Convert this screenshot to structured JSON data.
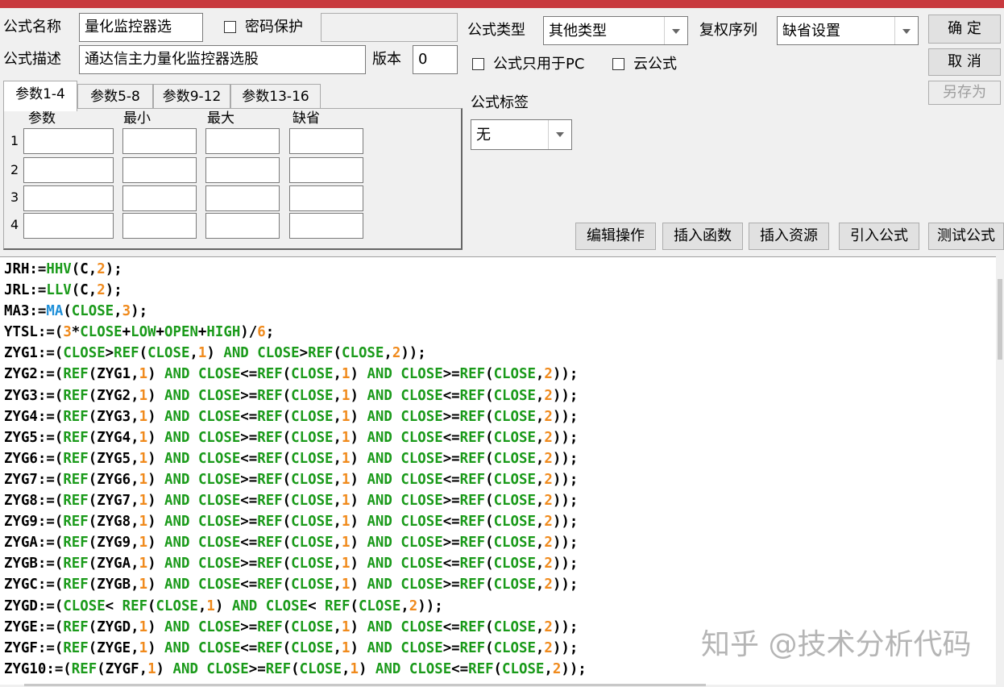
{
  "window": {
    "title_bar_color": "#c8393e"
  },
  "form": {
    "name_label": "公式名称",
    "name_value": "量化监控器选",
    "password_label": "密码保护",
    "password_value": "",
    "desc_label": "公式描述",
    "desc_value": "通达信主力量化监控器选股",
    "version_label": "版本",
    "version_value": "0",
    "type_label": "公式类型",
    "type_value": "其他类型",
    "adjust_label": "复权序列",
    "adjust_value": "缺省设置",
    "pc_only_label": "公式只用于PC",
    "cloud_label": "云公式",
    "tag_label": "公式标签",
    "tag_value": "无"
  },
  "buttons": {
    "ok": "确 定",
    "cancel": "取 消",
    "save_as": "另存为",
    "edit_ops": "编辑操作",
    "insert_func": "插入函数",
    "insert_res": "插入资源",
    "import_formula": "引入公式",
    "test_formula": "测试公式"
  },
  "tabs": [
    "参数1-4",
    "参数5-8",
    "参数9-12",
    "参数13-16"
  ],
  "param_table": {
    "headers": [
      "参数",
      "最小",
      "最大",
      "缺省"
    ],
    "rows": [
      "1",
      "2",
      "3",
      "4"
    ]
  },
  "code_lines": [
    "JRH:=HHV(C,2);",
    "JRL:=LLV(C,2);",
    "MA3:=MA(CLOSE,3);",
    "YTSL:=(3*CLOSE+LOW+OPEN+HIGH)/6;",
    "ZYG1:=(CLOSE>REF(CLOSE,1) AND CLOSE>REF(CLOSE,2));",
    "ZYG2:=(REF(ZYG1,1) AND CLOSE<=REF(CLOSE,1) AND CLOSE>=REF(CLOSE,2));",
    "ZYG3:=(REF(ZYG2,1) AND CLOSE>=REF(CLOSE,1) AND CLOSE<=REF(CLOSE,2));",
    "ZYG4:=(REF(ZYG3,1) AND CLOSE<=REF(CLOSE,1) AND CLOSE>=REF(CLOSE,2));",
    "ZYG5:=(REF(ZYG4,1) AND CLOSE>=REF(CLOSE,1) AND CLOSE<=REF(CLOSE,2));",
    "ZYG6:=(REF(ZYG5,1) AND CLOSE<=REF(CLOSE,1) AND CLOSE>=REF(CLOSE,2));",
    "ZYG7:=(REF(ZYG6,1) AND CLOSE>=REF(CLOSE,1) AND CLOSE<=REF(CLOSE,2));",
    "ZYG8:=(REF(ZYG7,1) AND CLOSE<=REF(CLOSE,1) AND CLOSE>=REF(CLOSE,2));",
    "ZYG9:=(REF(ZYG8,1) AND CLOSE>=REF(CLOSE,1) AND CLOSE<=REF(CLOSE,2));",
    "ZYGA:=(REF(ZYG9,1) AND CLOSE<=REF(CLOSE,1) AND CLOSE>=REF(CLOSE,2));",
    "ZYGB:=(REF(ZYGA,1) AND CLOSE>=REF(CLOSE,1) AND CLOSE<=REF(CLOSE,2));",
    "ZYGC:=(REF(ZYGB,1) AND CLOSE<=REF(CLOSE,1) AND CLOSE>=REF(CLOSE,2));",
    "ZYGD:=(CLOSE< REF(CLOSE,1) AND CLOSE< REF(CLOSE,2));",
    "ZYGE:=(REF(ZYGD,1) AND CLOSE>=REF(CLOSE,1) AND CLOSE<=REF(CLOSE,2));",
    "ZYGF:=(REF(ZYGE,1) AND CLOSE<=REF(CLOSE,1) AND CLOSE>=REF(CLOSE,2));",
    "ZYG10:=(REF(ZYGF,1) AND CLOSE>=REF(CLOSE,1) AND CLOSE<=REF(CLOSE,2));"
  ],
  "colors": {
    "function": "#1a9a1a",
    "number": "#f08a1c",
    "ma_function": "#1e8fd8"
  },
  "watermark": "知乎 @技术分析代码"
}
